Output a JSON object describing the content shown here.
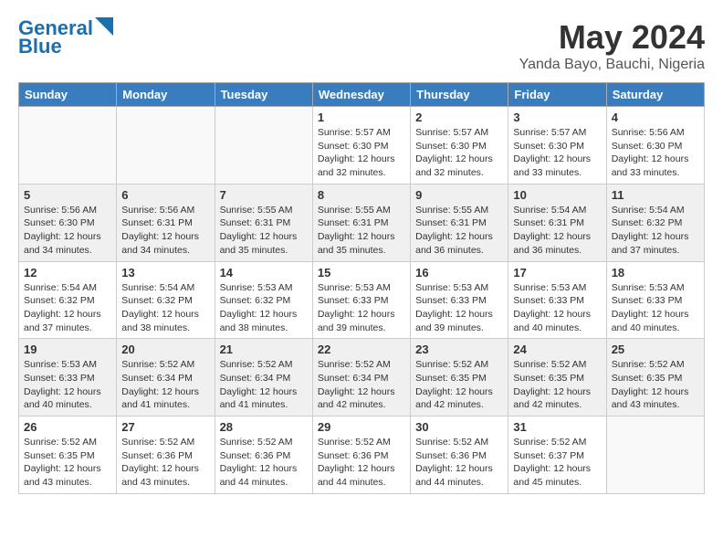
{
  "header": {
    "logo_line1": "General",
    "logo_line2": "Blue",
    "title": "May 2024",
    "subtitle": "Yanda Bayo, Bauchi, Nigeria"
  },
  "calendar": {
    "days_of_week": [
      "Sunday",
      "Monday",
      "Tuesday",
      "Wednesday",
      "Thursday",
      "Friday",
      "Saturday"
    ],
    "weeks": [
      [
        {
          "day": "",
          "info": ""
        },
        {
          "day": "",
          "info": ""
        },
        {
          "day": "",
          "info": ""
        },
        {
          "day": "1",
          "info": "Sunrise: 5:57 AM\nSunset: 6:30 PM\nDaylight: 12 hours\nand 32 minutes."
        },
        {
          "day": "2",
          "info": "Sunrise: 5:57 AM\nSunset: 6:30 PM\nDaylight: 12 hours\nand 32 minutes."
        },
        {
          "day": "3",
          "info": "Sunrise: 5:57 AM\nSunset: 6:30 PM\nDaylight: 12 hours\nand 33 minutes."
        },
        {
          "day": "4",
          "info": "Sunrise: 5:56 AM\nSunset: 6:30 PM\nDaylight: 12 hours\nand 33 minutes."
        }
      ],
      [
        {
          "day": "5",
          "info": "Sunrise: 5:56 AM\nSunset: 6:30 PM\nDaylight: 12 hours\nand 34 minutes."
        },
        {
          "day": "6",
          "info": "Sunrise: 5:56 AM\nSunset: 6:31 PM\nDaylight: 12 hours\nand 34 minutes."
        },
        {
          "day": "7",
          "info": "Sunrise: 5:55 AM\nSunset: 6:31 PM\nDaylight: 12 hours\nand 35 minutes."
        },
        {
          "day": "8",
          "info": "Sunrise: 5:55 AM\nSunset: 6:31 PM\nDaylight: 12 hours\nand 35 minutes."
        },
        {
          "day": "9",
          "info": "Sunrise: 5:55 AM\nSunset: 6:31 PM\nDaylight: 12 hours\nand 36 minutes."
        },
        {
          "day": "10",
          "info": "Sunrise: 5:54 AM\nSunset: 6:31 PM\nDaylight: 12 hours\nand 36 minutes."
        },
        {
          "day": "11",
          "info": "Sunrise: 5:54 AM\nSunset: 6:32 PM\nDaylight: 12 hours\nand 37 minutes."
        }
      ],
      [
        {
          "day": "12",
          "info": "Sunrise: 5:54 AM\nSunset: 6:32 PM\nDaylight: 12 hours\nand 37 minutes."
        },
        {
          "day": "13",
          "info": "Sunrise: 5:54 AM\nSunset: 6:32 PM\nDaylight: 12 hours\nand 38 minutes."
        },
        {
          "day": "14",
          "info": "Sunrise: 5:53 AM\nSunset: 6:32 PM\nDaylight: 12 hours\nand 38 minutes."
        },
        {
          "day": "15",
          "info": "Sunrise: 5:53 AM\nSunset: 6:33 PM\nDaylight: 12 hours\nand 39 minutes."
        },
        {
          "day": "16",
          "info": "Sunrise: 5:53 AM\nSunset: 6:33 PM\nDaylight: 12 hours\nand 39 minutes."
        },
        {
          "day": "17",
          "info": "Sunrise: 5:53 AM\nSunset: 6:33 PM\nDaylight: 12 hours\nand 40 minutes."
        },
        {
          "day": "18",
          "info": "Sunrise: 5:53 AM\nSunset: 6:33 PM\nDaylight: 12 hours\nand 40 minutes."
        }
      ],
      [
        {
          "day": "19",
          "info": "Sunrise: 5:53 AM\nSunset: 6:33 PM\nDaylight: 12 hours\nand 40 minutes."
        },
        {
          "day": "20",
          "info": "Sunrise: 5:52 AM\nSunset: 6:34 PM\nDaylight: 12 hours\nand 41 minutes."
        },
        {
          "day": "21",
          "info": "Sunrise: 5:52 AM\nSunset: 6:34 PM\nDaylight: 12 hours\nand 41 minutes."
        },
        {
          "day": "22",
          "info": "Sunrise: 5:52 AM\nSunset: 6:34 PM\nDaylight: 12 hours\nand 42 minutes."
        },
        {
          "day": "23",
          "info": "Sunrise: 5:52 AM\nSunset: 6:35 PM\nDaylight: 12 hours\nand 42 minutes."
        },
        {
          "day": "24",
          "info": "Sunrise: 5:52 AM\nSunset: 6:35 PM\nDaylight: 12 hours\nand 42 minutes."
        },
        {
          "day": "25",
          "info": "Sunrise: 5:52 AM\nSunset: 6:35 PM\nDaylight: 12 hours\nand 43 minutes."
        }
      ],
      [
        {
          "day": "26",
          "info": "Sunrise: 5:52 AM\nSunset: 6:35 PM\nDaylight: 12 hours\nand 43 minutes."
        },
        {
          "day": "27",
          "info": "Sunrise: 5:52 AM\nSunset: 6:36 PM\nDaylight: 12 hours\nand 43 minutes."
        },
        {
          "day": "28",
          "info": "Sunrise: 5:52 AM\nSunset: 6:36 PM\nDaylight: 12 hours\nand 44 minutes."
        },
        {
          "day": "29",
          "info": "Sunrise: 5:52 AM\nSunset: 6:36 PM\nDaylight: 12 hours\nand 44 minutes."
        },
        {
          "day": "30",
          "info": "Sunrise: 5:52 AM\nSunset: 6:36 PM\nDaylight: 12 hours\nand 44 minutes."
        },
        {
          "day": "31",
          "info": "Sunrise: 5:52 AM\nSunset: 6:37 PM\nDaylight: 12 hours\nand 45 minutes."
        },
        {
          "day": "",
          "info": ""
        }
      ]
    ]
  }
}
